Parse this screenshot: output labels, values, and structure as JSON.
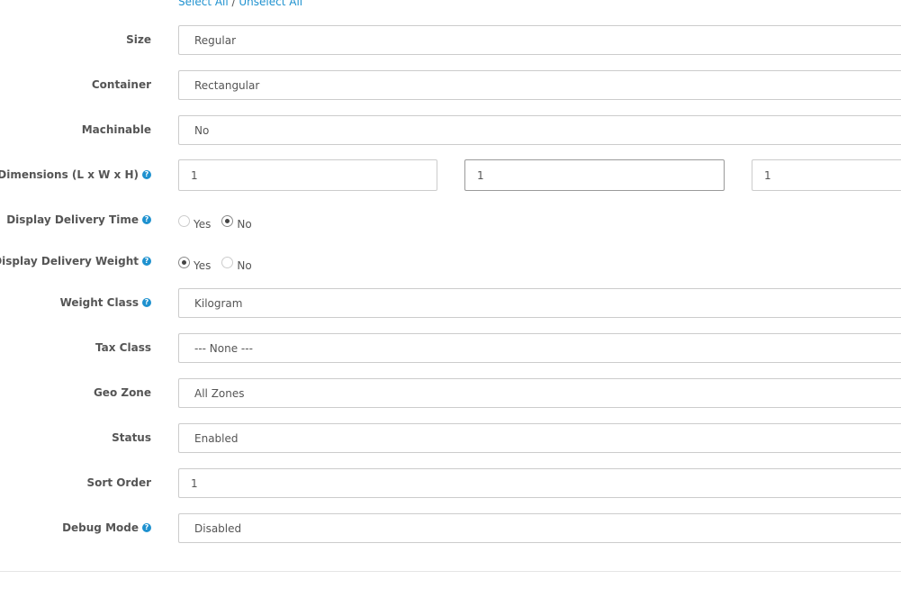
{
  "links": {
    "select_all": "Select All",
    "separator": " / ",
    "unselect_all": "Unselect All"
  },
  "fields": {
    "size": {
      "label": "Size",
      "value": "Regular"
    },
    "container": {
      "label": "Container",
      "value": "Rectangular"
    },
    "machinable": {
      "label": "Machinable",
      "value": "No"
    },
    "dimensions": {
      "required": "*",
      "label": "Dimensions (L x W x H)",
      "length": "1",
      "width": "1",
      "height": "1"
    },
    "display_delivery_time": {
      "label": "Display Delivery Time",
      "yes": "Yes",
      "no": "No",
      "selected": "No"
    },
    "display_delivery_weight": {
      "label": "Display Delivery Weight",
      "yes": "Yes",
      "no": "No",
      "selected": "Yes"
    },
    "weight_class": {
      "label": "Weight Class",
      "value": "Kilogram"
    },
    "tax_class": {
      "label": "Tax Class",
      "value": "--- None ---"
    },
    "geo_zone": {
      "label": "Geo Zone",
      "value": "All Zones"
    },
    "status": {
      "label": "Status",
      "value": "Enabled"
    },
    "sort_order": {
      "label": "Sort Order",
      "value": "1"
    },
    "debug_mode": {
      "label": "Debug Mode",
      "value": "Disabled"
    }
  },
  "icons": {
    "help": "question-circle-icon"
  },
  "colors": {
    "link": "#1e91cf",
    "required": "#f56b6b",
    "border": "#cccccc"
  }
}
